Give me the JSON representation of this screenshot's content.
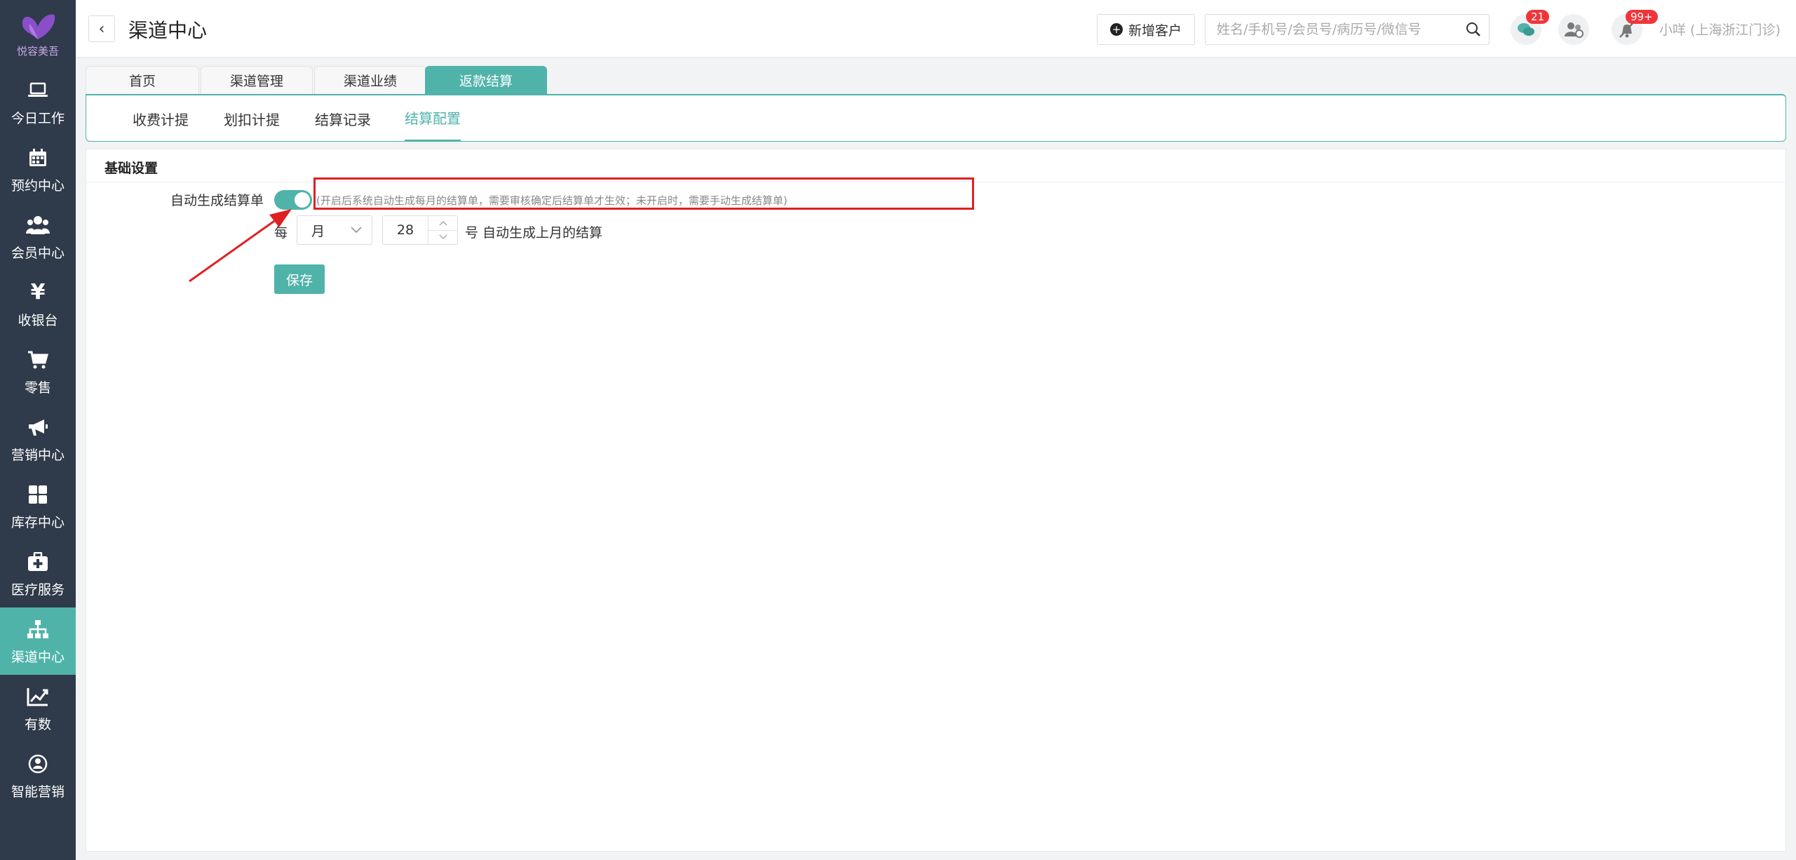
{
  "sidebar": {
    "logo_text": "悦容美吾",
    "items": [
      {
        "label": "今日工作",
        "icon": "laptop-icon"
      },
      {
        "label": "预约中心",
        "icon": "calendar-icon"
      },
      {
        "label": "会员中心",
        "icon": "users-icon"
      },
      {
        "label": "收银台",
        "icon": "yen-icon"
      },
      {
        "label": "零售",
        "icon": "cart-icon"
      },
      {
        "label": "营销中心",
        "icon": "megaphone-icon"
      },
      {
        "label": "库存中心",
        "icon": "grid-icon"
      },
      {
        "label": "医疗服务",
        "icon": "medkit-icon"
      },
      {
        "label": "渠道中心",
        "icon": "sitemap-icon"
      },
      {
        "label": "有数",
        "icon": "line-chart-icon"
      },
      {
        "label": "智能营销",
        "icon": "smart-icon"
      }
    ],
    "active_index": 8
  },
  "header": {
    "back_glyph": "‹",
    "title": "渠道中心",
    "add_customer_label": "新增客户",
    "search_placeholder": "姓名/手机号/会员号/病历号/微信号",
    "chat_badge": "21",
    "notify_badge": "99+",
    "user_name": "小咩 (上海浙江门诊)",
    "caret_glyph": "⌄"
  },
  "main_tabs": [
    {
      "label": "首页"
    },
    {
      "label": "渠道管理"
    },
    {
      "label": "渠道业绩"
    },
    {
      "label": "返款结算"
    }
  ],
  "main_tabs_active": 3,
  "sub_tabs": [
    {
      "label": "收费计提"
    },
    {
      "label": "划扣计提"
    },
    {
      "label": "结算记录"
    },
    {
      "label": "结算配置"
    }
  ],
  "sub_tabs_active": 3,
  "settings": {
    "section_title": "基础设置",
    "auto_label": "自动生成结算单",
    "auto_enabled": true,
    "hint": "(开启后系统自动生成每月的结算单，需要审核确定后结算单才生效；未开启时，需要手动生成结算单)",
    "every_label": "每",
    "period_value": "月",
    "day_value": "28",
    "suffix_label": "号 自动生成上月的结算",
    "save_label": "保存"
  },
  "colors": {
    "accent": "#4fb3aa",
    "sidebar_bg": "#2f3a4a",
    "annotation_red": "#e02020"
  }
}
